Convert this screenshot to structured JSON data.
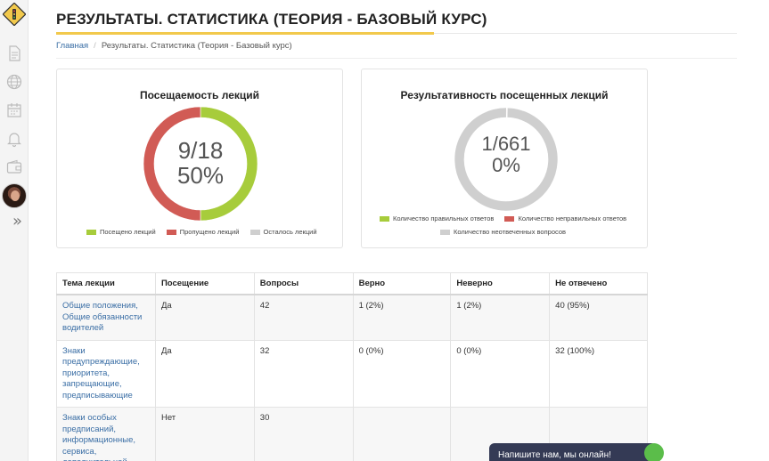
{
  "page": {
    "title": "РЕЗУЛЬТАТЫ. СТАТИСТИКА (ТЕОРИЯ - БАЗОВЫЙ КУРС)"
  },
  "breadcrumb": {
    "home": "Главная",
    "separator": "/",
    "current": "Результаты. Статистика (Теория - Базовый курс)"
  },
  "sidebar": {
    "icons": [
      "logo-road-sign-icon",
      "document-icon",
      "globe-icon",
      "calendar-icon",
      "bell-icon",
      "wallet-icon",
      "avatar",
      "double-chevron-right-icon"
    ]
  },
  "attendance_card": {
    "title": "Посещаемость лекций",
    "center_line1": "9/18",
    "center_line2": "50%",
    "legend": [
      {
        "label": "Посещено лекций",
        "color": "#a7cc3b"
      },
      {
        "label": "Пропущено лекций",
        "color": "#d15b55"
      },
      {
        "label": "Осталось лекций",
        "color": "#cfcfcf"
      }
    ]
  },
  "performance_card": {
    "title": "Результативность посещенных лекций",
    "center_line1": "1/661",
    "center_line2": "0%",
    "legend": [
      {
        "label": "Количество правильных ответов",
        "color": "#a7cc3b"
      },
      {
        "label": "Количество неправильных ответов",
        "color": "#d15b55"
      },
      {
        "label": "Количество неотвеченных вопросов",
        "color": "#cfcfcf"
      }
    ]
  },
  "chart_data": [
    {
      "type": "pie",
      "title": "Посещаемость лекций",
      "categories": [
        "Посещено лекций",
        "Пропущено лекций",
        "Осталось лекций"
      ],
      "values": [
        9,
        9,
        0
      ],
      "colors": [
        "#a7cc3b",
        "#d15b55",
        "#cfcfcf"
      ],
      "legend": "bottom"
    },
    {
      "type": "pie",
      "title": "Результативность посещенных лекций",
      "categories": [
        "Количество правильных ответов",
        "Количество неправильных ответов",
        "Количество неотвеченных вопросов"
      ],
      "values": [
        1,
        1,
        659
      ],
      "colors": [
        "#a7cc3b",
        "#d15b55",
        "#cfcfcf"
      ],
      "legend": "bottom"
    }
  ],
  "table": {
    "headers": [
      "Тема лекции",
      "Посещение",
      "Вопросы",
      "Верно",
      "Неверно",
      "Не отвечено"
    ],
    "rows": [
      {
        "topic": "Общие положения, Общие обязанности водителей",
        "attendance": "Да",
        "questions": "42",
        "correct": "1 (2%)",
        "wrong": "1 (2%)",
        "unanswered": "40 (95%)"
      },
      {
        "topic": "Знаки предупреждающие, приоритета, запрещающие, предписывающие",
        "attendance": "Да",
        "questions": "32",
        "correct": "0 (0%)",
        "wrong": "0 (0%)",
        "unanswered": "32 (100%)"
      },
      {
        "topic": "Знаки особых предписаний, информационные, сервиса, дополнительной",
        "attendance": "Нет",
        "questions": "30",
        "correct": "",
        "wrong": "",
        "unanswered": ""
      }
    ]
  },
  "chat": {
    "label": "Напишите нам, мы онлайн!"
  }
}
